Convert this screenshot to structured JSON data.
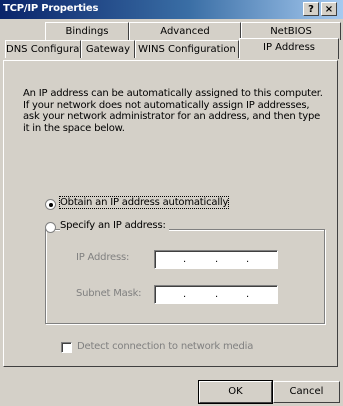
{
  "window": {
    "title": "TCP/IP Properties",
    "help_label": "?",
    "close_label": "×"
  },
  "tabs": [
    {
      "label": "Bindings"
    },
    {
      "label": "Advanced"
    },
    {
      "label": "NetBIOS"
    },
    {
      "label": "DNS Configuration"
    },
    {
      "label": "Gateway"
    },
    {
      "label": "WINS Configuration"
    },
    {
      "label": "IP Address",
      "active": true
    }
  ],
  "ip_tab": {
    "description": "An IP address can be automatically assigned to this computer. If your network does not automatically assign IP addresses, ask your network administrator for an address, and then type it in the space below.",
    "option_auto": {
      "label": "Obtain an IP address automatically",
      "selected": true
    },
    "option_specify": {
      "label": "Specify an IP address:",
      "selected": false
    },
    "ip_address": {
      "label": "IP Address:",
      "value": ". . ."
    },
    "subnet_mask": {
      "label": "Subnet Mask:",
      "value": ". . ."
    },
    "detect": {
      "label": "Detect connection to network media",
      "checked": false
    }
  },
  "buttons": {
    "ok_label": "OK",
    "cancel_label": "Cancel"
  }
}
